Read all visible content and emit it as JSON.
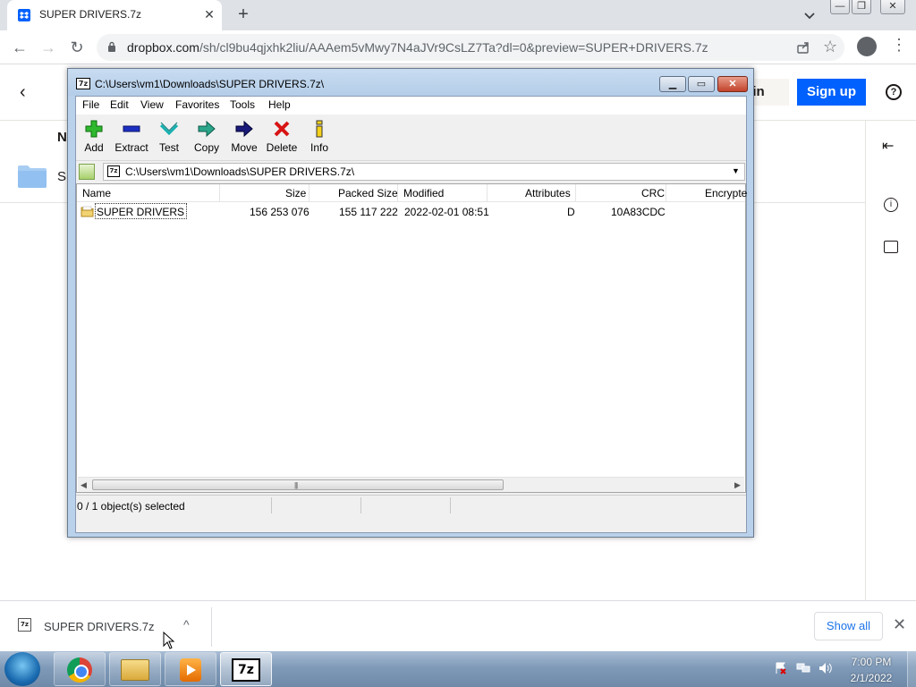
{
  "browser": {
    "tab_title": "SUPER DRIVERS.7z",
    "tab_close": "✕",
    "new_tab": "+",
    "url_host": "dropbox.com",
    "url_rest": "/sh/cl9bu4qjxhk2liu/AAAem5vMwy7N4aJVr9CsLZ7Ta?dl=0&preview=SUPER+DRIVERS.7z",
    "back": "←",
    "forward": "→",
    "reload": "↻",
    "star": "☆",
    "menu": "⋮",
    "window_min": "—",
    "window_restore": "❐",
    "window_close": "✕"
  },
  "dropbox": {
    "back": "‹",
    "signin": "n in",
    "signup": "Sign up",
    "help": "?",
    "name_header": "N",
    "file_name": "S",
    "collapse": "⇤",
    "info": "i",
    "accent": "#0061fe"
  },
  "sevenzip": {
    "title": "C:\\Users\\vm1\\Downloads\\SUPER DRIVERS.7z\\",
    "title_icon": "7z",
    "min": "▁",
    "max": "▭",
    "close": "✕",
    "menu": [
      "File",
      "Edit",
      "View",
      "Favorites",
      "Tools",
      "Help"
    ],
    "toolbar": [
      {
        "label": "Add",
        "icon": "add-icon"
      },
      {
        "label": "Extract",
        "icon": "extract-icon"
      },
      {
        "label": "Test",
        "icon": "test-icon"
      },
      {
        "label": "Copy",
        "icon": "copy-icon"
      },
      {
        "label": "Move",
        "icon": "move-icon"
      },
      {
        "label": "Delete",
        "icon": "delete-icon"
      },
      {
        "label": "Info",
        "icon": "info-icon"
      }
    ],
    "path": "C:\\Users\\vm1\\Downloads\\SUPER DRIVERS.7z\\",
    "columns": [
      "Name",
      "Size",
      "Packed Size",
      "Modified",
      "Attributes",
      "CRC",
      "Encrypte"
    ],
    "rows": [
      {
        "name": "SUPER DRIVERS",
        "size": "156 253 076",
        "packed": "155 117 222",
        "modified": "2022-02-01 08:51",
        "attributes": "D",
        "crc": "10A83CDC"
      }
    ],
    "status": "0 / 1 object(s) selected"
  },
  "download_shelf": {
    "file": "SUPER DRIVERS.7z",
    "chevron": "^",
    "show_all": "Show all",
    "close": "✕"
  },
  "taskbar": {
    "pinned": [
      "chrome-icon",
      "explorer-icon",
      "media-player-icon",
      "7zip-icon"
    ],
    "zip_label": "7z",
    "time": "7:00 PM",
    "date": "2/1/2022"
  }
}
